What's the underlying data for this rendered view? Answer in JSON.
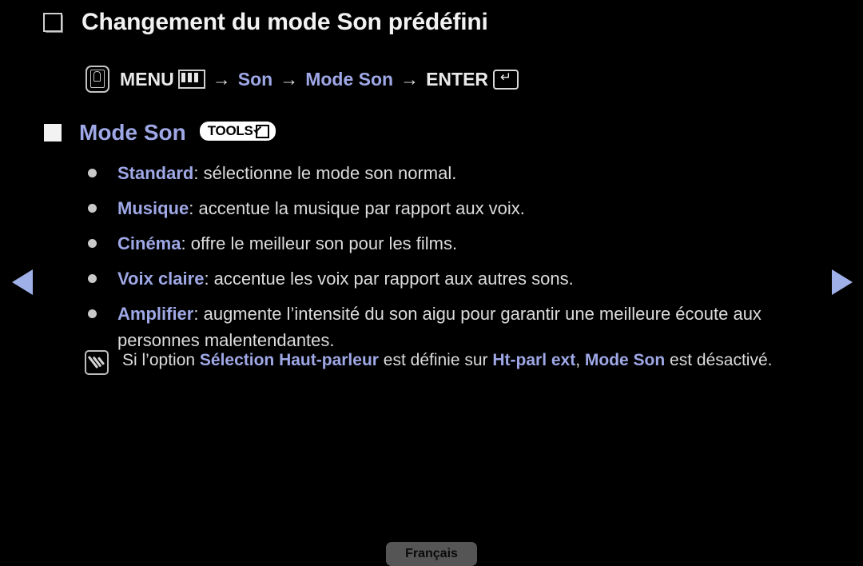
{
  "page": {
    "background_color": "#000000",
    "accent_color": "#9fa8e6",
    "text_color": "#dcdcdc",
    "title": "Changement du mode Son prédéfini"
  },
  "menu_path": {
    "menu_label": "MENU",
    "menu_icon": "remote-menu-button-icon",
    "bars_icon": "menu-bars-icon",
    "arrow1": "→",
    "item1": "Son",
    "arrow2": "→",
    "item2": "Mode Son",
    "arrow3": "→",
    "enter_label": "ENTER",
    "enter_icon": "enter-return-icon"
  },
  "section": {
    "bullet_icon": "filled-square-bullet",
    "title": "Mode Son",
    "badge_label": "TOOLS",
    "badge_icon": "tools-arrow-box-icon"
  },
  "bullets": [
    {
      "term": "Standard",
      "sep": ": ",
      "desc": "sélectionne le mode son normal."
    },
    {
      "term": "Musique",
      "sep": ": ",
      "desc": "accentue la musique par rapport aux voix."
    },
    {
      "term": "Cinéma",
      "sep": ": ",
      "desc": "offre le meilleur son pour les films."
    },
    {
      "term": "Voix claire",
      "sep": ": ",
      "desc": "accentue les voix par rapport aux autres sons."
    },
    {
      "term": "Amplifier",
      "sep": ": ",
      "desc": "augmente l’intensité du son aigu pour garantir une meilleure écoute aux personnes malentendantes."
    }
  ],
  "note": {
    "icon": "note-pencil-icon",
    "part1": "Si l’option ",
    "highlight1": "Sélection Haut-parleur",
    "part2": " est définie sur ",
    "highlight2": "Ht-parl ext",
    "part3": ", ",
    "highlight3": "Mode Son",
    "part4": " est désactivé."
  },
  "navigation": {
    "prev_label": "previous-page",
    "next_label": "next-page",
    "arrow_color": "#9fb0e8"
  },
  "footer": {
    "language_label": "Français"
  }
}
